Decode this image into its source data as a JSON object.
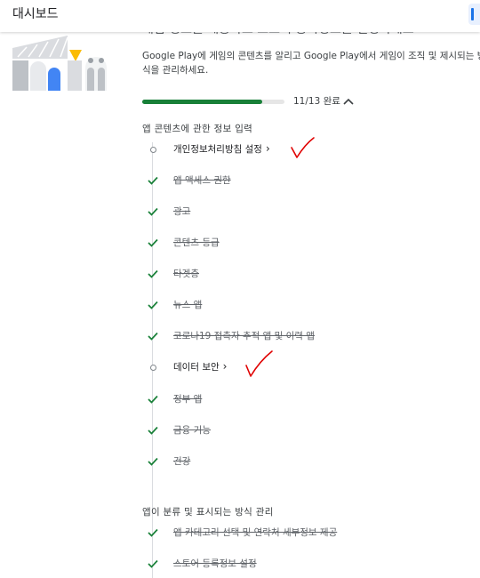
{
  "header": {
    "title": "대시보드"
  },
  "intro": {
    "headline": "게임 정보를 제공하고 스토어 등록정보를 설정하세요",
    "description": "Google Play에 게임의 콘텐츠를 알리고 Google Play에서 게임이 조직 및 제시되는 방식을 관리하세요."
  },
  "progress": {
    "completed": 11,
    "total": 13,
    "text": "11/13 완료"
  },
  "sections": [
    {
      "heading": "앱 콘텐츠에 관한 정보 입력",
      "items": [
        {
          "label": "개인정보처리방침 설정",
          "done": false
        },
        {
          "label": "앱 액세스 권한",
          "done": true
        },
        {
          "label": "광고",
          "done": true
        },
        {
          "label": "콘텐츠 등급",
          "done": true
        },
        {
          "label": "타겟층",
          "done": true
        },
        {
          "label": "뉴스 앱",
          "done": true
        },
        {
          "label": "코로나19 접촉자 추적 앱 및 이력 앱",
          "done": true
        },
        {
          "label": "데이터 보안",
          "done": false
        },
        {
          "label": "정부 앱",
          "done": true
        },
        {
          "label": "금융 기능",
          "done": true
        },
        {
          "label": "건강",
          "done": true
        }
      ]
    },
    {
      "heading": "앱이 분류 및 표시되는 방식 관리",
      "items": [
        {
          "label": "앱 카테고리 선택 및 연락처 세부정보 제공",
          "done": true
        },
        {
          "label": "스토어 등록정보 설정",
          "done": true
        }
      ]
    }
  ],
  "icons": {
    "done": "check-icon",
    "todo": "circle-icon",
    "open": "chevron-right-icon",
    "collapse": "chevron-up-icon"
  },
  "colors": {
    "done": "#188038",
    "progress": "#188038",
    "annotation": "#e00000",
    "accent": "#1a73e8"
  }
}
